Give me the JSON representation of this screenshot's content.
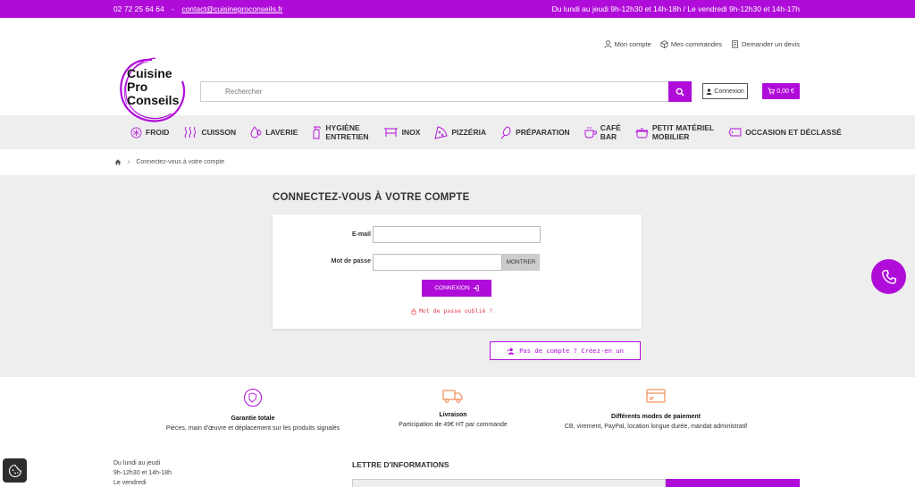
{
  "topbar": {
    "phone": "02 72 25 64 64",
    "separator": "-",
    "email": "contact@cuisineproconseils.fr",
    "hours": "Du lundi au jeudi 9h-12h30 et 14h-18h / Le vendredi 9h-12h30 et 14h-17h"
  },
  "userlinks": {
    "account": "Mon compte",
    "orders": "Mes commandes",
    "quote": "Demander un devis"
  },
  "logo": {
    "line1": "Cuisine",
    "line2": "Pro",
    "line3": "Conseils"
  },
  "search": {
    "placeholder": "Rechercher"
  },
  "header": {
    "login_label": "Connexion",
    "cart_label": "0,00 €"
  },
  "nav": [
    {
      "label": "FROID",
      "icon": "snowflake-icon"
    },
    {
      "label": "CUISSON",
      "icon": "heat-waves-icon"
    },
    {
      "label": "LAVERIE",
      "icon": "water-drops-icon"
    },
    {
      "label": "HYGIÈNE ENTRETIEN",
      "line1": "HYGIÈNE",
      "line2": "ENTRETIEN",
      "icon": "spray-bottle-icon"
    },
    {
      "label": "INOX",
      "icon": "steel-table-icon"
    },
    {
      "label": "PIZZÉRIA",
      "icon": "pizza-icon"
    },
    {
      "label": "PRÉPARATION",
      "icon": "whisk-icon"
    },
    {
      "label": "CAFÉ BAR",
      "line1": "CAFÉ",
      "line2": "BAR",
      "icon": "coffee-cup-icon"
    },
    {
      "label": "PETIT MATÉRIEL MOBILIER",
      "line1": "PETIT MATÉRIEL",
      "line2": "MOBILIER",
      "icon": "pot-icon"
    },
    {
      "label": "OCCASION ET DÉCLASSÉ",
      "icon": "tag-icon"
    }
  ],
  "breadcrumb": {
    "current": "Connectez-vous à votre compte"
  },
  "login": {
    "title": "CONNECTEZ-VOUS À VOTRE COMPTE",
    "email_label": "E-mail",
    "password_label": "Mot de passe",
    "show_label": "MONTRER",
    "submit_label": "CONNEXION",
    "forgot_label": "Mot de passe oublié ?",
    "create_label": "Pas de compte ? Créez-en un"
  },
  "reassurance": [
    {
      "title": "Garantie totale",
      "desc": "Pièces, main d'œuvre et déplacement sur les produits signalés",
      "icon": "shield-icon"
    },
    {
      "title": "Livraison",
      "desc": "Participation de 49€ HT par commande",
      "icon": "delivery-truck-icon"
    },
    {
      "title": "Différents modes de paiement",
      "desc": "CB, virement, PayPal, location longue durée, mandat administratif",
      "icon": "payment-card-icon"
    }
  ],
  "footer": {
    "hours_line1": "Du lundi au jeudi",
    "hours_line2": "9h-12h30 et 14h-18h",
    "hours_line3": "Le vendredi",
    "newsletter_title": "LETTRE D'INFORMATIONS"
  },
  "colors": {
    "accent": "#b00cd9",
    "error": "#e63c4d",
    "band": "#eeeeee"
  }
}
